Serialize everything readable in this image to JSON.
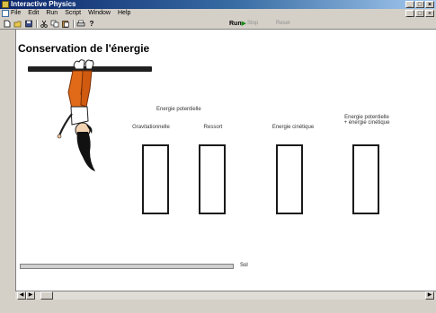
{
  "window": {
    "title": "Interactive Physics",
    "controls": [
      "_",
      "□",
      "×"
    ]
  },
  "menubar": {
    "items": [
      "File",
      "Edit",
      "Run",
      "Script",
      "Window",
      "Help"
    ]
  },
  "toolbar": {
    "run_label": "Run",
    "stop_label": "Stop",
    "reset_label": "Reset",
    "run_icon": "play-icon"
  },
  "canvas": {
    "title": "Conservation de l'énergie",
    "potential_header": "Energie potentielle",
    "columns": [
      {
        "label": "Gravitationnelle",
        "line2": ""
      },
      {
        "label": "Ressort",
        "line2": ""
      },
      {
        "label": "Energie cinétique",
        "line2": ""
      },
      {
        "label": "Energie potentielle",
        "line2": "+ énergie cinétique"
      }
    ],
    "ground_label": "Sol"
  },
  "colors": {
    "title_bar": "#0a246a",
    "figure_clothes": "#e06a18",
    "box_border": "#1a1a1a"
  }
}
